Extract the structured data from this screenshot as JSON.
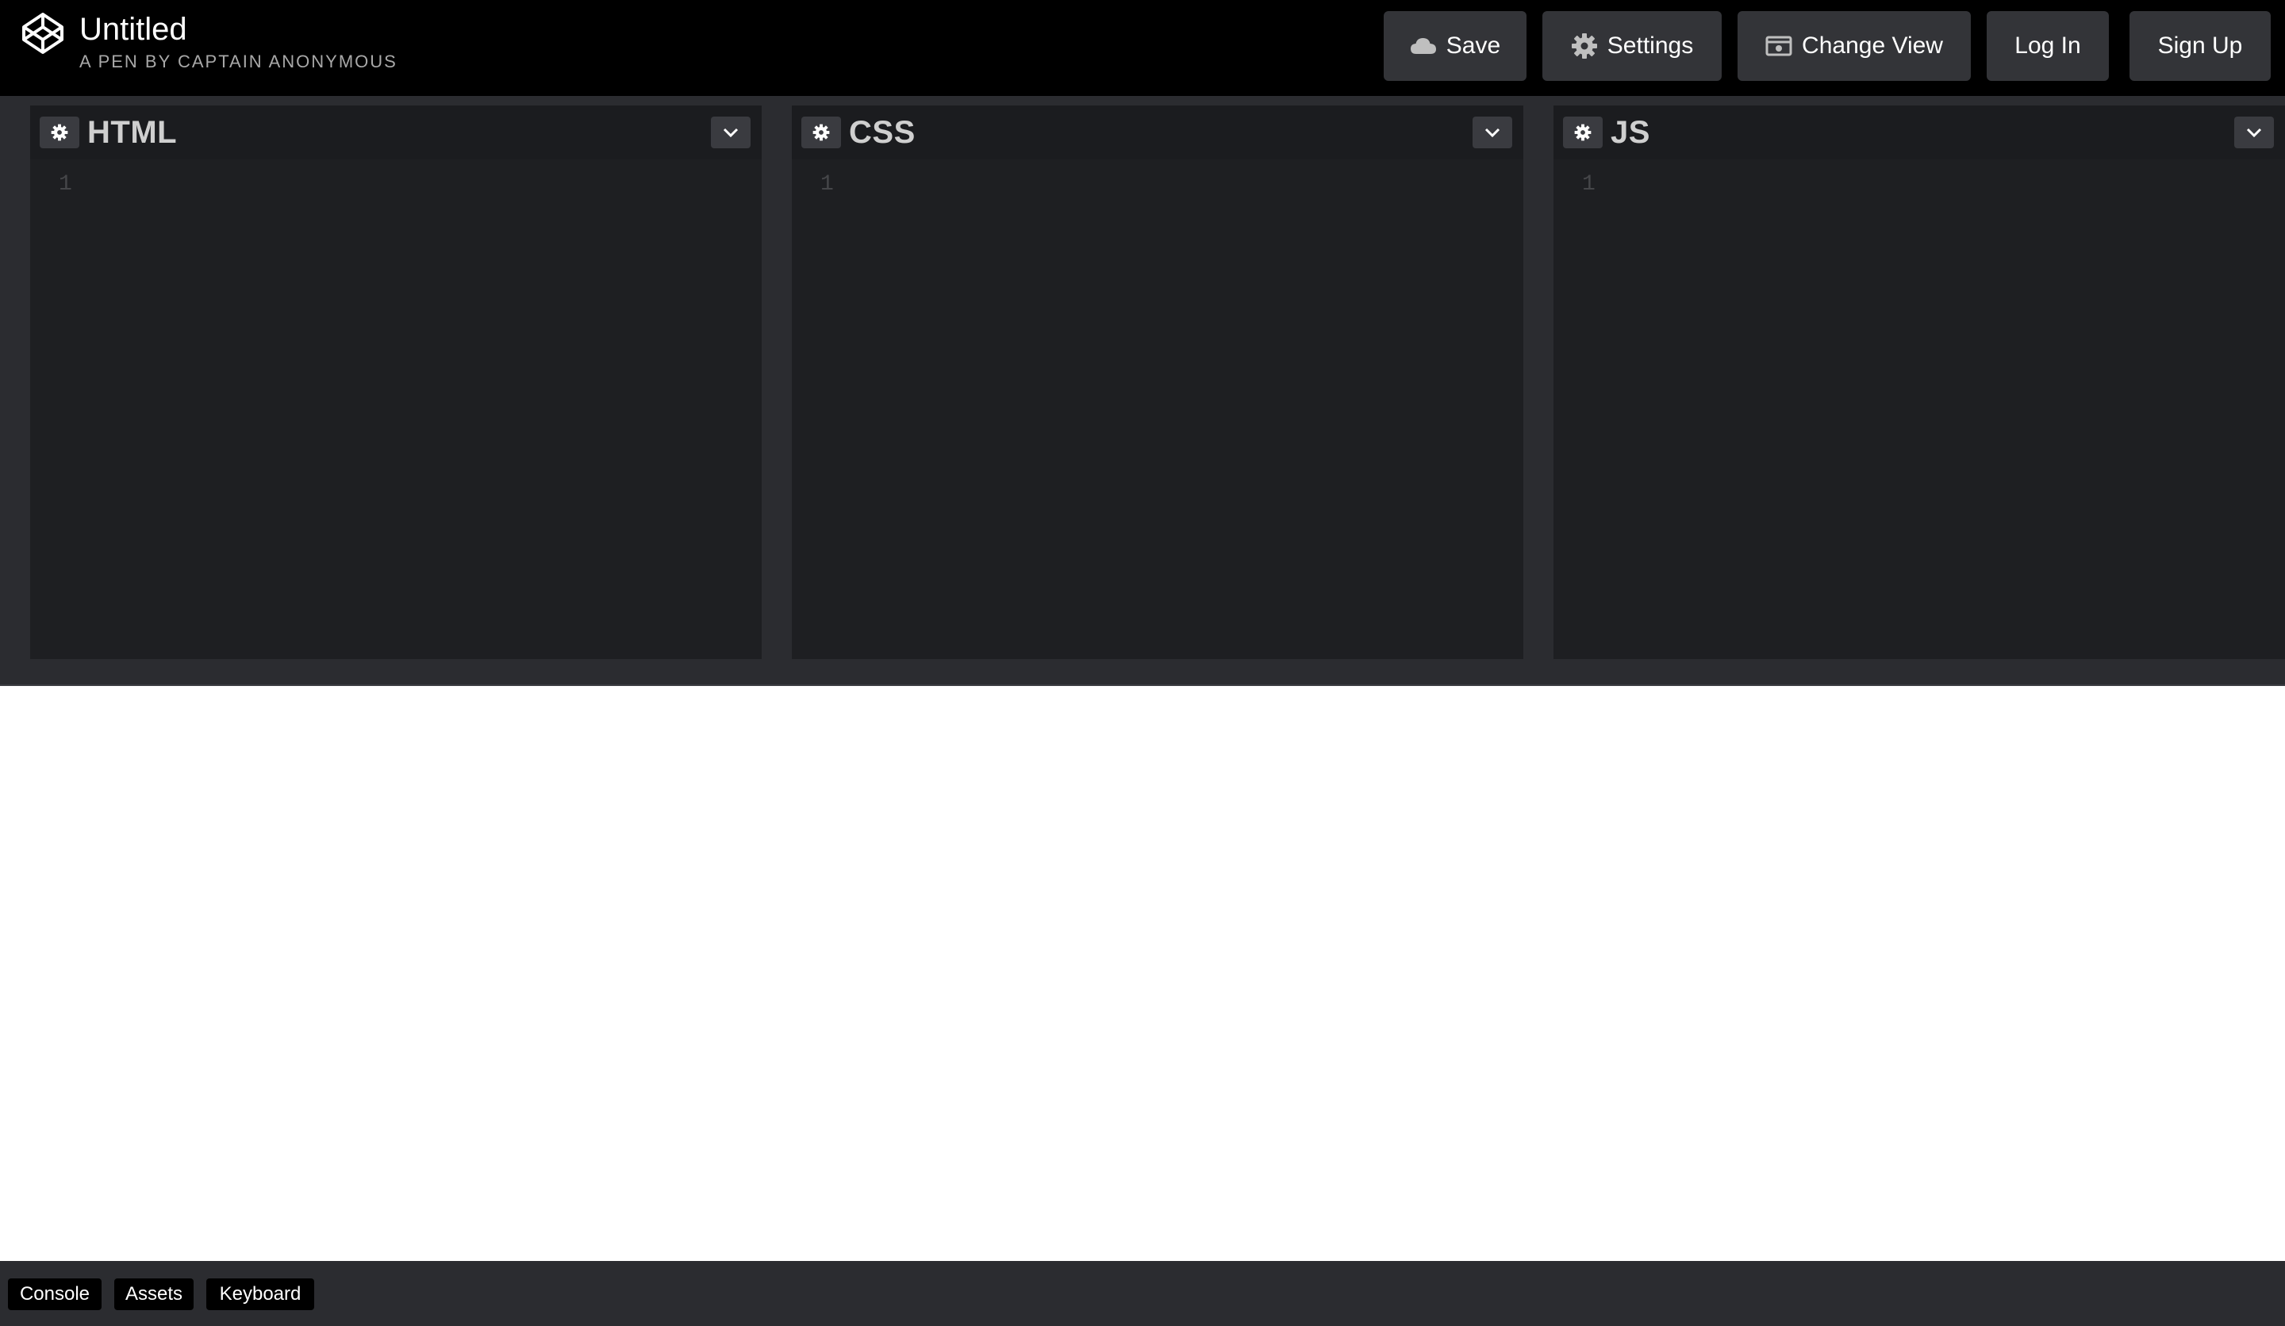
{
  "header": {
    "title": "Untitled",
    "subtitle": "A PEN BY CAPTAIN ANONYMOUS",
    "buttons": {
      "save": "Save",
      "settings": "Settings",
      "change_view": "Change View",
      "log_in": "Log In",
      "sign_up": "Sign Up"
    }
  },
  "editors": [
    {
      "label": "HTML",
      "line_number": "1"
    },
    {
      "label": "CSS",
      "line_number": "1"
    },
    {
      "label": "JS",
      "line_number": "1"
    }
  ],
  "footer": {
    "buttons": [
      "Console",
      "Assets",
      "Keyboard"
    ]
  },
  "icons": {
    "logo": "codepen-logo-icon",
    "save": "cloud-icon",
    "settings": "gear-icon",
    "change_view": "view-icon",
    "editor_settings": "gear-icon",
    "editor_toggle": "chevron-down-icon"
  },
  "colors": {
    "header_bg": "#000000",
    "button_bg": "#333438",
    "editor_bg": "#1e1f22",
    "editor_header_bg": "#1b1c1f",
    "gutter": "#2b2c30",
    "preview_bg": "#ffffff"
  }
}
